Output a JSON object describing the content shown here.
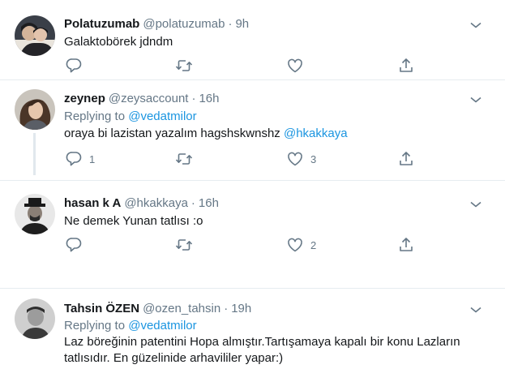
{
  "tweets": [
    {
      "name": "Polatuzumab",
      "handle": "@polatuzumab",
      "time": "9h",
      "text": "Galaktoburek jdndm",
      "text_exact": "Galaktobörek jdndm",
      "reply_count": "",
      "like_count": ""
    },
    {
      "name": "zeynep",
      "handle": "@zeysaccount",
      "time": "16h",
      "replying_prefix": "Replying to",
      "replying_to": "@vedatmilor",
      "text": "oraya bi lazistan yazalım hagshskwnshz",
      "text_mention": "@hkakkaya",
      "reply_count": "1",
      "like_count": "3"
    },
    {
      "name": "hasan k A",
      "handle": "@hkakkaya",
      "time": "16h",
      "text": "Ne demek Yunan tatlısı :o",
      "reply_count": "",
      "like_count": "2"
    },
    {
      "name": "Tahsin ÖZEN",
      "handle": "@ozen_tahsin",
      "time": "19h",
      "replying_prefix": "Replying to",
      "replying_to": "@vedatmilor",
      "text_line1": "Laz böreğinin patentini Hopa almıştır.Tartışamaya kapalı bir konu Lazların",
      "text_line2": "tatlısıdır. En güzelinide arhavililer yapar:)"
    }
  ],
  "dot": "·",
  "icons": [
    "chevron-down-icon",
    "reply-icon",
    "retweet-icon",
    "like-icon",
    "share-icon"
  ],
  "colors": {
    "link": "#1b95e0",
    "secondary": "#657786",
    "thread_line": "#e1e8ed"
  }
}
